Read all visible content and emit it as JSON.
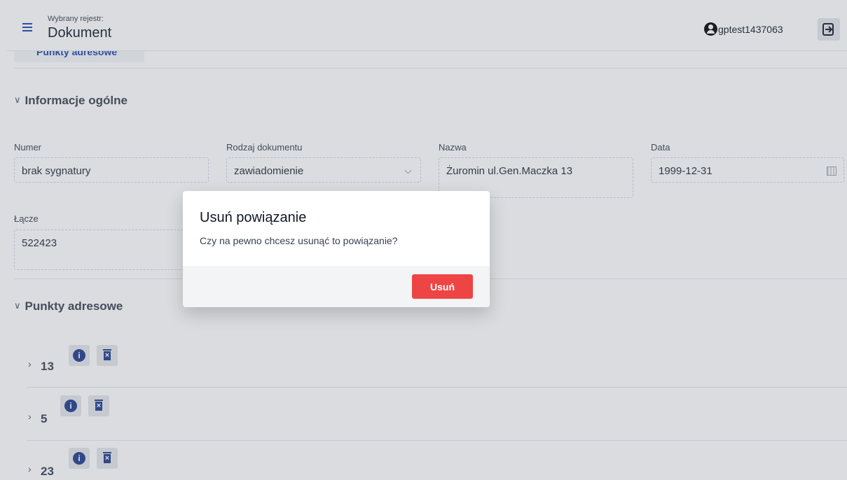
{
  "header": {
    "sub_label": "Wybrany rejestr:",
    "title": "Dokument",
    "user_name": "gptest1437063"
  },
  "top_tab": {
    "label": "Punkty adresowe"
  },
  "section_general": {
    "title": "Informacje ogólne",
    "fields": {
      "numer": {
        "label": "Numer",
        "value": "brak sygnatury"
      },
      "rodzaj": {
        "label": "Rodzaj dokumentu",
        "value": "zawiadomienie"
      },
      "nazwa": {
        "label": "Nazwa",
        "value": "Żuromin ul.Gen.Maczka 13"
      },
      "data": {
        "label": "Data",
        "value": "1999-12-31"
      },
      "lacze": {
        "label": "Łącze",
        "value": "522423"
      }
    }
  },
  "section_points": {
    "title": "Punkty adresowe",
    "items": [
      {
        "num": "13"
      },
      {
        "num": "5"
      },
      {
        "num": "23"
      }
    ]
  },
  "modal": {
    "title": "Usuń powiązanie",
    "message": "Czy na pewno chcesz usunąć to powiązanie?",
    "confirm_label": "Usuń"
  },
  "colors": {
    "accent": "#1e40af",
    "danger": "#ef4444",
    "icon": "#1e3a8a"
  }
}
